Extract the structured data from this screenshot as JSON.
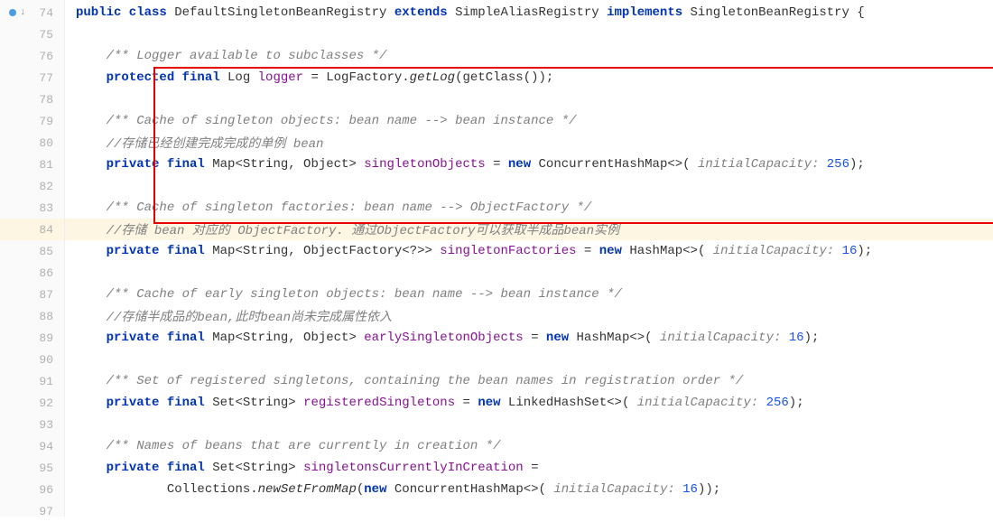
{
  "lines": [
    {
      "num": "74",
      "indent": 0,
      "hl": false,
      "dot": true,
      "arrow": true,
      "seg": [
        {
          "t": "public class ",
          "c": "kw"
        },
        {
          "t": "DefaultSingletonBeanRegistry ",
          "c": "cls"
        },
        {
          "t": "extends ",
          "c": "kw"
        },
        {
          "t": "SimpleAliasRegistry ",
          "c": "cls"
        },
        {
          "t": "implements ",
          "c": "kw"
        },
        {
          "t": "SingletonBeanRegistry ",
          "c": "cls"
        },
        {
          "t": "{",
          "c": "plain"
        }
      ]
    },
    {
      "num": "75",
      "indent": 0,
      "hl": false,
      "seg": []
    },
    {
      "num": "76",
      "indent": 1,
      "hl": false,
      "seg": [
        {
          "t": "/** Logger available to subclasses */",
          "c": "cmt"
        }
      ]
    },
    {
      "num": "77",
      "indent": 1,
      "hl": false,
      "seg": [
        {
          "t": "protected final ",
          "c": "kw"
        },
        {
          "t": "Log ",
          "c": "cls"
        },
        {
          "t": "logger ",
          "c": "field"
        },
        {
          "t": "= LogFactory.",
          "c": "plain"
        },
        {
          "t": "getLog",
          "c": "mtd"
        },
        {
          "t": "(getClass());",
          "c": "plain"
        }
      ]
    },
    {
      "num": "78",
      "indent": 0,
      "hl": false,
      "seg": []
    },
    {
      "num": "79",
      "indent": 1,
      "hl": false,
      "seg": [
        {
          "t": "/** Cache of singleton objects: bean name --> bean instance */",
          "c": "cmt"
        }
      ]
    },
    {
      "num": "80",
      "indent": 1,
      "hl": false,
      "seg": [
        {
          "t": "//存储已经创建完成完成的单例 bean",
          "c": "cmt"
        }
      ]
    },
    {
      "num": "81",
      "indent": 1,
      "hl": false,
      "seg": [
        {
          "t": "private final ",
          "c": "kw"
        },
        {
          "t": "Map<String, Object> ",
          "c": "cls"
        },
        {
          "t": "singletonObjects ",
          "c": "field"
        },
        {
          "t": "= ",
          "c": "plain"
        },
        {
          "t": "new ",
          "c": "kw"
        },
        {
          "t": "ConcurrentHashMap<>( ",
          "c": "cls"
        },
        {
          "t": "initialCapacity: ",
          "c": "cmt-label"
        },
        {
          "t": "256",
          "c": "num"
        },
        {
          "t": ");",
          "c": "plain"
        }
      ]
    },
    {
      "num": "82",
      "indent": 0,
      "hl": false,
      "seg": []
    },
    {
      "num": "83",
      "indent": 1,
      "hl": false,
      "seg": [
        {
          "t": "/** Cache of singleton factories: bean name --> ObjectFactory */",
          "c": "cmt"
        }
      ]
    },
    {
      "num": "84",
      "indent": 1,
      "hl": true,
      "seg": [
        {
          "t": "//存储 bean 对应的 ObjectFactory. 通过ObjectFactory可以获取半成品bean实例",
          "c": "cmt"
        }
      ]
    },
    {
      "num": "85",
      "indent": 1,
      "hl": false,
      "seg": [
        {
          "t": "private final ",
          "c": "kw"
        },
        {
          "t": "Map<String, ObjectFactory<?>> ",
          "c": "cls"
        },
        {
          "t": "singletonFactories ",
          "c": "field"
        },
        {
          "t": "= ",
          "c": "plain"
        },
        {
          "t": "new ",
          "c": "kw"
        },
        {
          "t": "HashMap<>( ",
          "c": "cls"
        },
        {
          "t": "initialCapacity: ",
          "c": "cmt-label"
        },
        {
          "t": "16",
          "c": "num"
        },
        {
          "t": ");",
          "c": "plain"
        }
      ]
    },
    {
      "num": "86",
      "indent": 0,
      "hl": false,
      "seg": []
    },
    {
      "num": "87",
      "indent": 1,
      "hl": false,
      "seg": [
        {
          "t": "/** Cache of early singleton objects: bean name --> bean instance */",
          "c": "cmt"
        }
      ]
    },
    {
      "num": "88",
      "indent": 1,
      "hl": false,
      "seg": [
        {
          "t": "//存储半成品的bean,此时bean尚未完成属性依入",
          "c": "cmt"
        }
      ]
    },
    {
      "num": "89",
      "indent": 1,
      "hl": false,
      "seg": [
        {
          "t": "private final ",
          "c": "kw"
        },
        {
          "t": "Map<String, Object> ",
          "c": "cls"
        },
        {
          "t": "earlySingletonObjects ",
          "c": "field"
        },
        {
          "t": "= ",
          "c": "plain"
        },
        {
          "t": "new ",
          "c": "kw"
        },
        {
          "t": "HashMap<>( ",
          "c": "cls"
        },
        {
          "t": "initialCapacity: ",
          "c": "cmt-label"
        },
        {
          "t": "16",
          "c": "num"
        },
        {
          "t": ");",
          "c": "plain"
        }
      ]
    },
    {
      "num": "90",
      "indent": 0,
      "hl": false,
      "seg": []
    },
    {
      "num": "91",
      "indent": 1,
      "hl": false,
      "seg": [
        {
          "t": "/** Set of registered singletons, containing the bean names in registration order */",
          "c": "cmt"
        }
      ]
    },
    {
      "num": "92",
      "indent": 1,
      "hl": false,
      "seg": [
        {
          "t": "private final ",
          "c": "kw"
        },
        {
          "t": "Set<String> ",
          "c": "cls"
        },
        {
          "t": "registeredSingletons ",
          "c": "field"
        },
        {
          "t": "= ",
          "c": "plain"
        },
        {
          "t": "new ",
          "c": "kw"
        },
        {
          "t": "LinkedHashSet<>( ",
          "c": "cls"
        },
        {
          "t": "initialCapacity: ",
          "c": "cmt-label"
        },
        {
          "t": "256",
          "c": "num"
        },
        {
          "t": ");",
          "c": "plain"
        }
      ]
    },
    {
      "num": "93",
      "indent": 0,
      "hl": false,
      "seg": []
    },
    {
      "num": "94",
      "indent": 1,
      "hl": false,
      "seg": [
        {
          "t": "/** Names of beans that are currently in creation */",
          "c": "cmt"
        }
      ]
    },
    {
      "num": "95",
      "indent": 1,
      "hl": false,
      "seg": [
        {
          "t": "private final ",
          "c": "kw"
        },
        {
          "t": "Set<String> ",
          "c": "cls"
        },
        {
          "t": "singletonsCurrentlyInCreation ",
          "c": "field"
        },
        {
          "t": "=",
          "c": "plain"
        }
      ]
    },
    {
      "num": "96",
      "indent": 3,
      "hl": false,
      "seg": [
        {
          "t": "Collections.",
          "c": "plain"
        },
        {
          "t": "newSetFromMap",
          "c": "mtd"
        },
        {
          "t": "(",
          "c": "plain"
        },
        {
          "t": "new ",
          "c": "kw"
        },
        {
          "t": "ConcurrentHashMap<>( ",
          "c": "cls"
        },
        {
          "t": "initialCapacity: ",
          "c": "cmt-label"
        },
        {
          "t": "16",
          "c": "num"
        },
        {
          "t": "));",
          "c": "plain"
        }
      ]
    },
    {
      "num": "97",
      "indent": 0,
      "hl": false,
      "seg": []
    }
  ]
}
